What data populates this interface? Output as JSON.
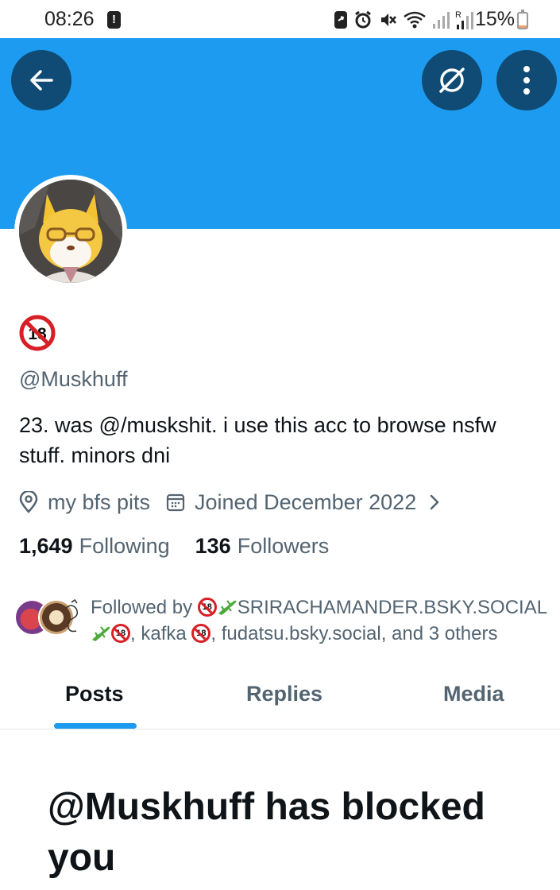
{
  "status_bar": {
    "time": "08:26",
    "battery_percent": "15%",
    "battery_level": 0.15,
    "icons": [
      "notification-alert-icon",
      "sync-icon",
      "alarm-icon",
      "mute-icon",
      "wifi-icon",
      "signal-icon",
      "roaming-signal-icon",
      "battery-icon"
    ]
  },
  "header": {
    "banner_color": "#1d9bf0",
    "back_icon": "arrow-left-icon",
    "grok_icon": "grok-icon",
    "more_icon": "more-vertical-icon"
  },
  "profile": {
    "display_name_emoji": "🔞",
    "handle": "@Muskhuff",
    "bio": "23. was @/muskshit. i use this acc to browse nsfw stuff. minors dni",
    "location": "my bfs pits",
    "joined": "Joined December 2022",
    "following_count": "1,649",
    "following_label": "Following",
    "followers_count": "136",
    "followers_label": "Followers"
  },
  "followed_by": {
    "prefix": "Followed by",
    "name1": "SRIRACHAMANDER.BSKY.SOCIAL",
    "sep1": ",",
    "name2": "kafka",
    "tail": ", fudatsu.bsky.social, and 3 others"
  },
  "tabs": [
    {
      "label": "Posts",
      "active": true
    },
    {
      "label": "Replies",
      "active": false
    },
    {
      "label": "Media",
      "active": false
    }
  ],
  "blocked_message": "@Muskhuff has blocked you",
  "colors": {
    "accent": "#1d9bf0",
    "text_primary": "#0f1419",
    "text_secondary": "#536471",
    "header_button": "#0f4b74"
  }
}
